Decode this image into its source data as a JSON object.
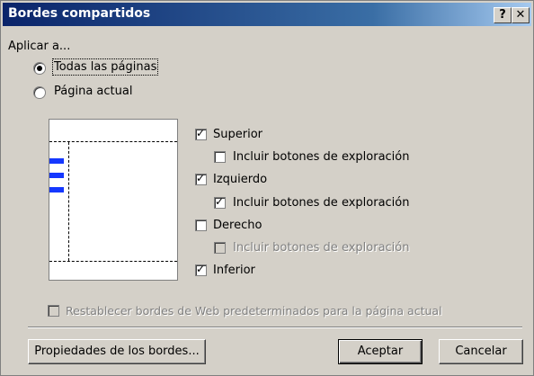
{
  "window": {
    "title": "Bordes compartidos",
    "help_label": "?",
    "close_label": "✕"
  },
  "apply": {
    "label": "Aplicar a...",
    "options": [
      {
        "label": "Todas las páginas",
        "selected": true
      },
      {
        "label": "Página actual",
        "selected": false
      }
    ]
  },
  "borders": [
    {
      "label": "Superior",
      "checked": true,
      "enabled": true
    },
    {
      "label": "Incluir botones de exploración",
      "checked": false,
      "enabled": true
    },
    {
      "label": "Izquierdo",
      "checked": true,
      "enabled": true
    },
    {
      "label": "Incluir botones de exploración",
      "checked": true,
      "enabled": true
    },
    {
      "label": "Derecho",
      "checked": false,
      "enabled": true
    },
    {
      "label": "Incluir botones de exploración",
      "checked": false,
      "enabled": false
    },
    {
      "label": "Inferior",
      "checked": true,
      "enabled": true
    }
  ],
  "reset": {
    "label": "Restablecer bordes de Web predeterminados para la página actual",
    "checked": false,
    "enabled": false
  },
  "buttons": {
    "properties": "Propiedades de los bordes...",
    "ok": "Aceptar",
    "cancel": "Cancelar"
  },
  "colors": {
    "titlebar": "#0a246a",
    "nav_bar": "#1538ff",
    "face": "#d4d0c8"
  }
}
